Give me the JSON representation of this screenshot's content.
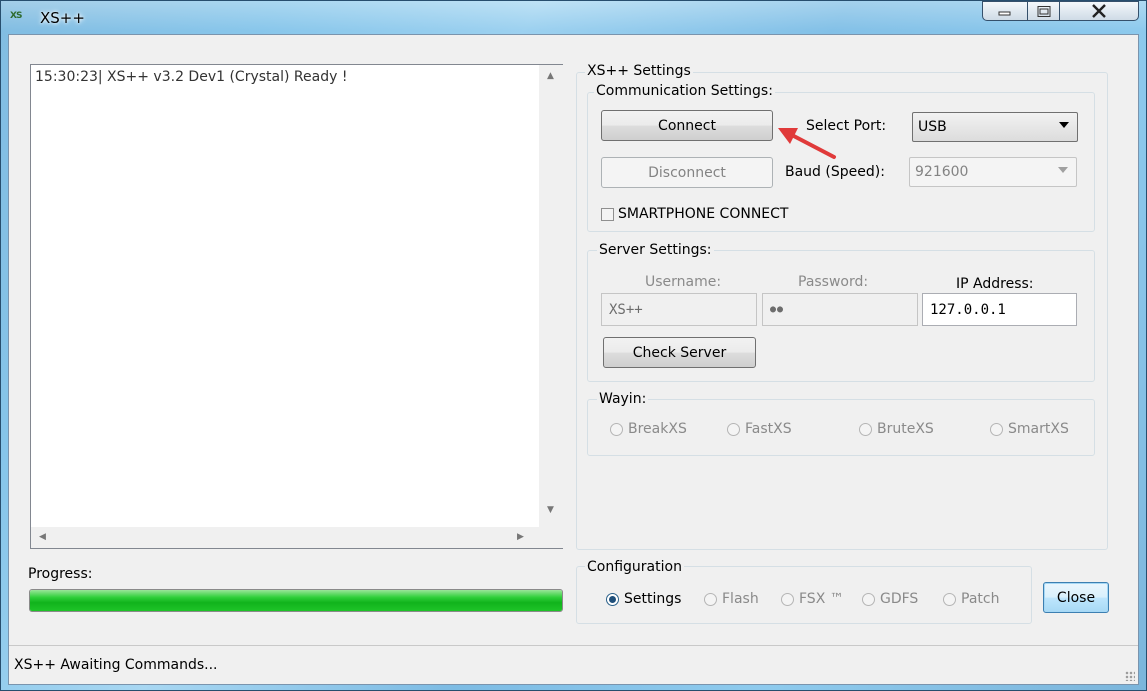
{
  "window": {
    "title": "XS++",
    "app_icon_text": "XS"
  },
  "log": {
    "lines": [
      "15:30:23| XS++ v3.2 Dev1 (Crystal) Ready !"
    ]
  },
  "settings": {
    "title": "XS++ Settings",
    "communication": {
      "title": "Communication Settings:",
      "connect_label": "Connect",
      "disconnect_label": "Disconnect",
      "select_port_label": "Select Port:",
      "port_value": "USB",
      "baud_label": "Baud (Speed):",
      "baud_value": "921600",
      "smartphone_label": "SMARTPHONE CONNECT",
      "smartphone_checked": false
    },
    "server": {
      "title": "Server Settings:",
      "username_label": "Username:",
      "password_label": "Password:",
      "ip_label": "IP Address:",
      "username_value": "XS++",
      "password_value": "●●",
      "ip_value": "127.0.0.1",
      "check_server_label": "Check Server"
    },
    "wayin": {
      "title": "Wayin:",
      "options": [
        "BreakXS",
        "FastXS",
        "BruteXS",
        "SmartXS"
      ]
    }
  },
  "progress": {
    "label": "Progress:",
    "value": 1.0
  },
  "configuration": {
    "title": "Configuration",
    "options": [
      "Settings",
      "Flash",
      "FSX ™",
      "GDFS",
      "Patch"
    ],
    "selected": "Settings"
  },
  "close_label": "Close",
  "status": {
    "text": "XS++ Awaiting Commands..."
  },
  "colors": {
    "progress_fill": "#1ec428",
    "annotation_arrow": "#e03a3a"
  },
  "icons": {
    "minimize": "minimize-icon",
    "maximize": "maximize-icon",
    "close": "close-icon"
  }
}
